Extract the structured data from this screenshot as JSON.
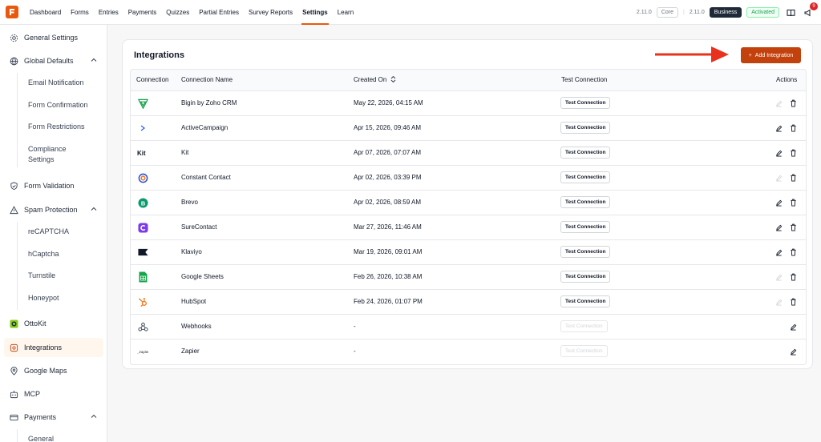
{
  "topbar": {
    "nav": [
      "Dashboard",
      "Forms",
      "Entries",
      "Payments",
      "Quizzes",
      "Partial Entries",
      "Survey Reports",
      "Settings",
      "Learn"
    ],
    "active_nav": "Settings",
    "version_core": "2.11.0",
    "core_label": "Core",
    "version_business": "2.11.0",
    "business_label": "Business",
    "activated_label": "Activated",
    "notification_count": "9"
  },
  "sidebar": {
    "general_settings": "General Settings",
    "global_defaults": "Global Defaults",
    "email_notification": "Email Notification",
    "form_confirmation": "Form Confirmation",
    "form_restrictions": "Form Restrictions",
    "compliance_settings_1": "Compliance",
    "compliance_settings_2": "Settings",
    "form_validation": "Form Validation",
    "spam_protection": "Spam Protection",
    "recaptcha": "reCAPTCHA",
    "hcaptcha": "hCaptcha",
    "turnstile": "Turnstile",
    "honeypot": "Honeypot",
    "ottokit": "OttoKit",
    "integrations": "Integrations",
    "google_maps": "Google Maps",
    "mcp": "MCP",
    "payments": "Payments",
    "general": "General"
  },
  "main": {
    "title": "Integrations",
    "add_button": "Add Integration",
    "columns": {
      "connection": "Connection",
      "connection_name": "Connection Name",
      "created_on": "Created On",
      "test_connection": "Test Connection",
      "actions": "Actions"
    },
    "rows": [
      {
        "name": "Bigin by Zoho CRM",
        "created": "May 22, 2026, 04:15 AM",
        "test": "Test Connection",
        "icon": "bigin-icon"
      },
      {
        "name": "ActiveCampaign",
        "created": "Apr 15, 2026, 09:46 AM",
        "test": "Test Connection",
        "icon": "activecampaign-icon"
      },
      {
        "name": "Kit",
        "created": "Apr 07, 2026, 07:07 AM",
        "test": "Test Connection",
        "icon": "kit-icon"
      },
      {
        "name": "Constant Contact",
        "created": "Apr 02, 2026, 03:39 PM",
        "test": "Test Connection",
        "icon": "constant-contact-icon"
      },
      {
        "name": "Brevo",
        "created": "Apr 02, 2026, 08:59 AM",
        "test": "Test Connection",
        "icon": "brevo-icon"
      },
      {
        "name": "SureContact",
        "created": "Mar 27, 2026, 11:46 AM",
        "test": "Test Connection",
        "icon": "surecontact-icon"
      },
      {
        "name": "Klaviyo",
        "created": "Mar 19, 2026, 09:01 AM",
        "test": "Test Connection",
        "icon": "klaviyo-icon"
      },
      {
        "name": "Google Sheets",
        "created": "Feb 26, 2026, 10:38 AM",
        "test": "Test Connection",
        "icon": "google-sheets-icon"
      },
      {
        "name": "HubSpot",
        "created": "Feb 24, 2026, 01:07 PM",
        "test": "Test Connection",
        "icon": "hubspot-icon"
      },
      {
        "name": "Webhooks",
        "created": "-",
        "test": "Test Connection",
        "icon": "webhooks-icon"
      },
      {
        "name": "Zapier",
        "created": "-",
        "test": "Test Connection",
        "icon": "zapier-icon"
      }
    ]
  },
  "colors": {
    "accent": "#c2410c",
    "arrow": "#e8321e"
  }
}
